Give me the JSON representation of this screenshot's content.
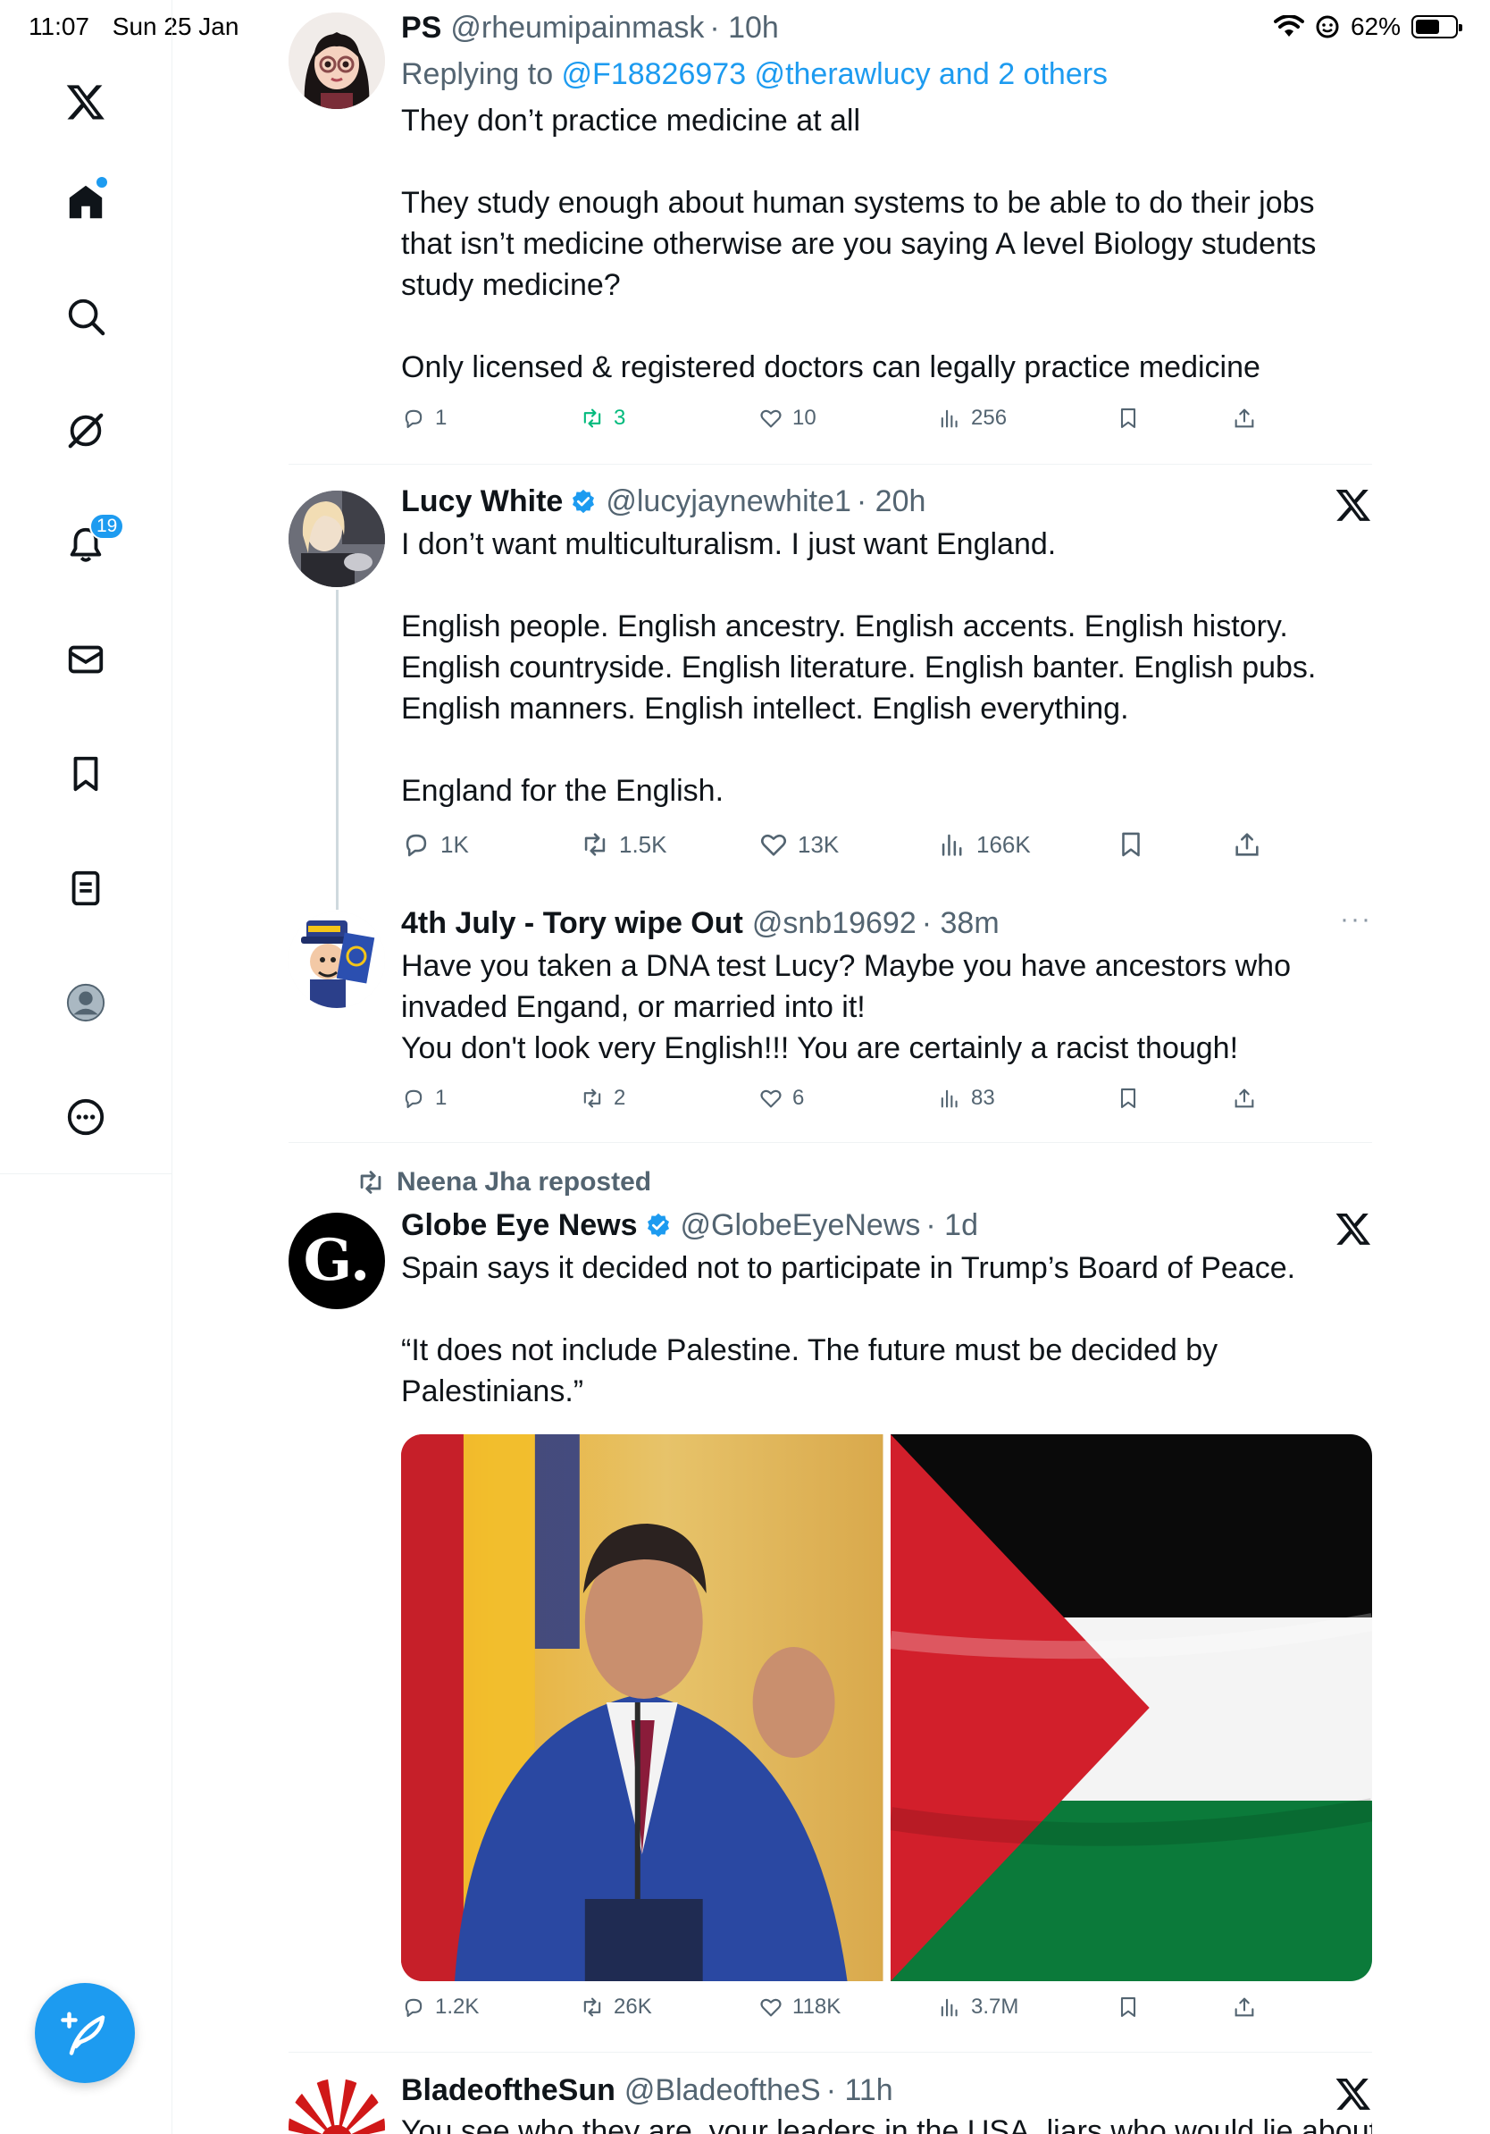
{
  "status_bar": {
    "time": "11:07",
    "date": "Sun 25 Jan",
    "battery": "62%",
    "battery_level": 0.62
  },
  "nav": {
    "notifications_badge": "19",
    "items": [
      "x-logo",
      "home",
      "search",
      "grok",
      "notifications",
      "messages",
      "bookmarks",
      "lists",
      "profile",
      "more"
    ]
  },
  "tweets": [
    {
      "name": "PS",
      "handle": "@rheumipainmask",
      "time": "· 10h",
      "reply_prefix": "Replying to ",
      "reply_to": "@F18826973 @therawlucy and 2 others",
      "text": "They don’t practice medicine at all\n\nThey study enough about human systems to be able to do their jobs that isn’t medicine otherwise are you saying A level Biology students study medicine?\n\nOnly licensed & registered doctors can legally practice medicine",
      "replies": "1",
      "reposts": "3",
      "likes": "10",
      "views": "256"
    },
    {
      "name": "Lucy White",
      "handle": "@lucyjaynewhite1",
      "time": "· 20h",
      "text": "I don’t want multiculturalism. I just want England.\n\nEnglish people. English ancestry. English accents. English history. English countryside. English literature. English banter. English pubs. English manners. English intellect. English everything.\n\nEngland for the English.",
      "replies": "1K",
      "reposts": "1.5K",
      "likes": "13K",
      "views": "166K"
    },
    {
      "name": "4th July - Tory wipe Out",
      "handle": "@snb19692",
      "time": "· 38m",
      "text": "Have you taken a DNA test Lucy? Maybe you have ancestors who invaded Engand, or married into it!\nYou don't look very English!!! You are certainly a racist though!",
      "replies": "1",
      "reposts": "2",
      "likes": "6",
      "views": "83"
    },
    {
      "repost_label": "Neena Jha reposted",
      "name": "Globe Eye News",
      "handle": "@GlobeEyeNews",
      "time": "· 1d",
      "avatar_letter": "G.",
      "text": "Spain says it decided not to participate in Trump’s Board of Peace.\n\n“It does not include Palestine. The future must be decided by Palestinians.”",
      "replies": "1.2K",
      "reposts": "26K",
      "likes": "118K",
      "views": "3.7M"
    },
    {
      "name": "BladeoftheSun",
      "handle": "@BladeoftheS",
      "time": "· 11h",
      "text": "You see who they are, your leaders in the USA, liars who would lie about"
    }
  ],
  "colors": {
    "accent": "#1d9bf0",
    "text": "#0f1419",
    "secondary": "#536471",
    "repost_green": "#00ba7c",
    "divider": "#eff3f4"
  }
}
